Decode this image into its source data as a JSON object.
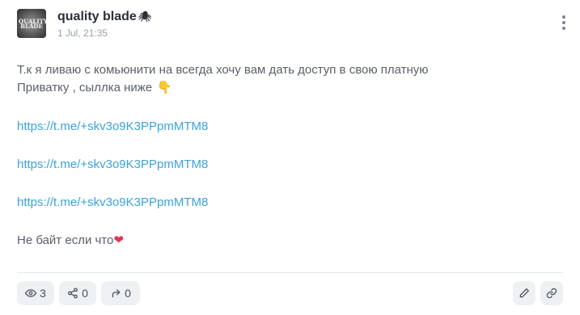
{
  "post": {
    "author": "quality blade",
    "author_badge": "🕷",
    "avatar_text": "QUALITY BLADE",
    "date": "1 Jul, 21:35",
    "text_line1": "Т.к я ливаю с комьюнити на всегда хочу вам дать доступ в свою платную",
    "text_line2": "Приватку , сыллка ниже",
    "text_line2_emoji": "👇",
    "links": [
      "https://t.me/+skv3o9K3PPpmMTM8",
      "https://t.me/+skv3o9K3PPpmMTM8",
      "https://t.me/+skv3o9K3PPpmMTM8"
    ],
    "closing": "Не байт если что",
    "closing_emoji": "❤"
  },
  "footer": {
    "views": "3",
    "shares": "0",
    "forwards": "0"
  },
  "icons": {
    "menu": "more-vertical-icon",
    "views": "eye-icon",
    "shares": "share-icon",
    "forwards": "forward-icon",
    "edit": "pencil-icon",
    "link": "link-icon"
  },
  "colors": {
    "link": "#3aa3dc",
    "pill_bg": "#eef1f4",
    "heart": "#e8335a"
  }
}
